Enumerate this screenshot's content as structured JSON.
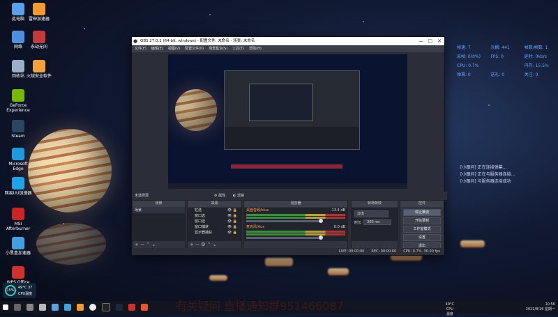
{
  "desktop_icons": [
    {
      "label": "此电脑",
      "color": "#5aa0e6"
    },
    {
      "label": "雷神加速器",
      "color": "#f29a2e"
    },
    {
      "label": "网络",
      "color": "#4d8fe0"
    },
    {
      "label": "永劫无间",
      "color": "#c23a3a"
    },
    {
      "label": "回收站",
      "color": "#9ab0c8"
    },
    {
      "label": "火绒安全软件",
      "color": "#f2a33a"
    },
    {
      "label": "GeForce Experience",
      "color": "#76b900"
    },
    {
      "label": "Steam",
      "color": "#2a475e"
    },
    {
      "label": "Microsoft Edge",
      "color": "#1c9adf"
    },
    {
      "label": "网易UU加速器",
      "color": "#1ea3e8"
    },
    {
      "label": "MSI Afterburner",
      "color": "#c92525"
    },
    {
      "label": "小黑盒加速器",
      "color": "#3fa1e0"
    },
    {
      "label": "WPS Office",
      "color": "#d0312d"
    }
  ],
  "obs": {
    "title": "OBS 27.0.1 (64-bit, windows) - 配置文件: 未命名 - 场景: 未命名",
    "menu": [
      "文件(F)",
      "编辑(E)",
      "视图(V)",
      "配置文件(P)",
      "场景集合(S)",
      "工具(T)",
      "帮助(H)"
    ],
    "status_label": "未选择源",
    "props_label": "属性",
    "filters_label": "滤镜",
    "scenes_dock": {
      "title": "场景",
      "items": [
        "场景"
      ]
    },
    "sources_dock": {
      "title": "来源",
      "items": [
        "粒选",
        "窗口选",
        "窗口选",
        "窗口捕获",
        "显示器捕获"
      ]
    },
    "mixer": {
      "title": "混音器",
      "tracks": [
        {
          "name": "桌面音频/blue",
          "db": "-13.4 dB"
        },
        {
          "name": "麦克风/Aux",
          "db": "0.0 dB"
        }
      ]
    },
    "transitions": {
      "title": "转场特效",
      "type": "淡出",
      "duration_label": "时长",
      "duration": "300 ms"
    },
    "controls": {
      "title": "控件",
      "buttons": [
        "停止推流",
        "开始录制",
        "工作室模式",
        "设置",
        "退出"
      ]
    },
    "statusbar": [
      "LIVE: 00:00:00",
      "REC: 00:00:00",
      "CPU: 0.7%, 30.00 fps"
    ]
  },
  "monitor": {
    "rows": [
      [
        "帧速: 7",
        "光栅: 441",
        "帧数/帧数: 1"
      ],
      [
        "采帧: 0(0%)",
        "FPS: 0",
        "延时: 0kb/s"
      ],
      [
        "CPU: 0.7%",
        "",
        "内存: 15.5%"
      ],
      [
        "弹幕: 0",
        "送礼: 0",
        "关注: 0"
      ]
    ]
  },
  "notifications": [
    "[小跟问] 正在连接弹幕...",
    "[小跟问] 正在与服务器连接...",
    "[小跟问] 与服务器连接成功"
  ],
  "overlay_banner": "有关疑问  直播通知群951466087",
  "taskbar": {
    "cpu_temp": "49°C",
    "cpu_label": "CPU温度",
    "time": "10:56",
    "date": "2021/8/16 星期一",
    "widget_percent": "15%",
    "widget_temp": "49°C 37",
    "widget_label": "CPU温度"
  }
}
